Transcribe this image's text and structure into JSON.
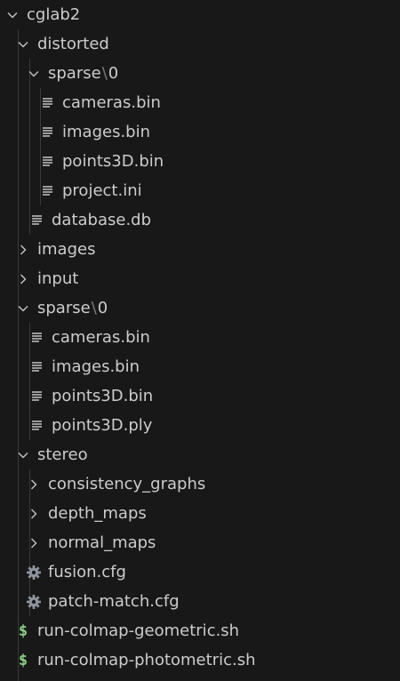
{
  "tree": {
    "root": {
      "label": "cglab2",
      "icon": "chevron-down-icon"
    },
    "distorted": {
      "label": "distorted",
      "icon": "chevron-down-icon"
    },
    "distorted_sparse": {
      "label": "sparse",
      "sep": "\\",
      "suffix": "0",
      "icon": "chevron-down-icon"
    },
    "distorted_sparse_files": [
      {
        "label": "cameras.bin",
        "icon": "text-file-icon"
      },
      {
        "label": "images.bin",
        "icon": "text-file-icon"
      },
      {
        "label": "points3D.bin",
        "icon": "text-file-icon"
      },
      {
        "label": "project.ini",
        "icon": "text-file-icon"
      }
    ],
    "distorted_files": [
      {
        "label": "database.db",
        "icon": "text-file-icon"
      }
    ],
    "images": {
      "label": "images",
      "icon": "chevron-right-icon"
    },
    "input": {
      "label": "input",
      "icon": "chevron-right-icon"
    },
    "sparse": {
      "label": "sparse",
      "sep": "\\",
      "suffix": "0",
      "icon": "chevron-down-icon"
    },
    "sparse_files": [
      {
        "label": "cameras.bin",
        "icon": "text-file-icon"
      },
      {
        "label": "images.bin",
        "icon": "text-file-icon"
      },
      {
        "label": "points3D.bin",
        "icon": "text-file-icon"
      },
      {
        "label": "points3D.ply",
        "icon": "text-file-icon"
      }
    ],
    "stereo": {
      "label": "stereo",
      "icon": "chevron-down-icon"
    },
    "stereo_folders": [
      {
        "label": "consistency_graphs",
        "icon": "chevron-right-icon"
      },
      {
        "label": "depth_maps",
        "icon": "chevron-right-icon"
      },
      {
        "label": "normal_maps",
        "icon": "chevron-right-icon"
      }
    ],
    "stereo_files": [
      {
        "label": "fusion.cfg",
        "icon": "gear-icon"
      },
      {
        "label": "patch-match.cfg",
        "icon": "gear-icon"
      }
    ],
    "scripts": [
      {
        "label": "run-colmap-geometric.sh",
        "icon": "dollar-icon"
      },
      {
        "label": "run-colmap-photometric.sh",
        "icon": "dollar-icon"
      }
    ]
  },
  "colors": {
    "background": "#181818",
    "text": "#cccccc",
    "icon": "#c5c5c5",
    "gear": "#8d959e",
    "shell": "#89d185",
    "guide": "#3a3a3a"
  }
}
